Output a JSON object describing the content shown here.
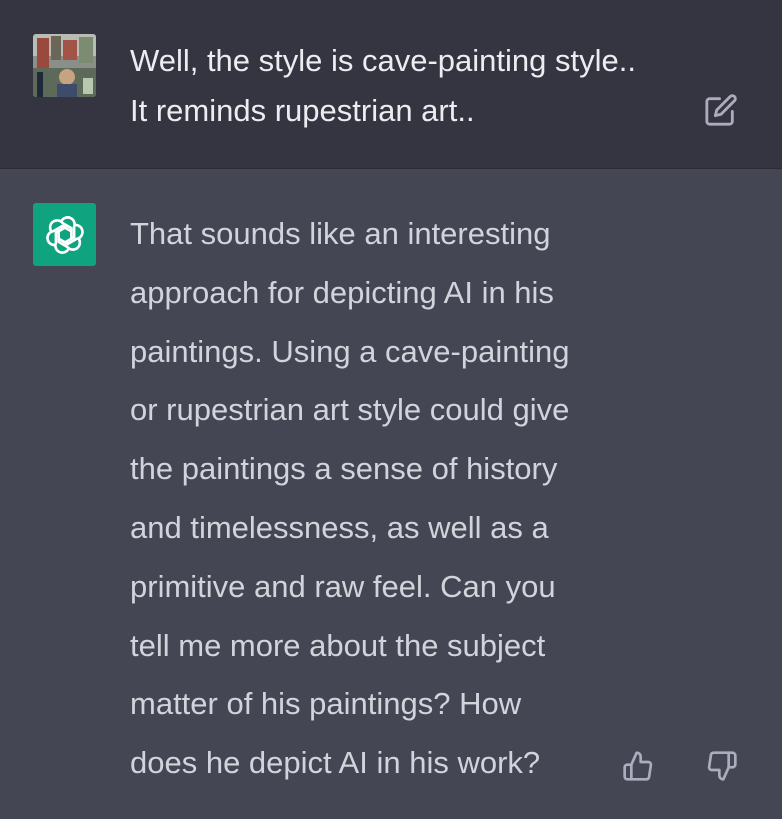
{
  "conversation": {
    "user_message": {
      "text": "Well, the style is cave-painting style..\nIt reminds rupestrian art..",
      "avatar_icon": "user-avatar-photo",
      "edit_icon": "edit-pencil-icon"
    },
    "assistant_message": {
      "text": "That sounds like an interesting\napproach for depicting AI in his\npaintings. Using a cave-painting\nor rupestrian art style could give\nthe paintings a sense of history\nand timelessness, as well as a\nprimitive and raw feel. Can you\ntell me more about the subject\nmatter of his paintings? How\ndoes he depict AI in his work?",
      "avatar_icon": "openai-logo-icon",
      "thumbs_up_icon": "thumbs-up-icon",
      "thumbs_down_icon": "thumbs-down-icon"
    }
  },
  "colors": {
    "user_bg": "#343541",
    "assistant_bg": "#444654",
    "accent": "#10a37f",
    "text": "#d1d5db",
    "icon": "#acacbe"
  }
}
